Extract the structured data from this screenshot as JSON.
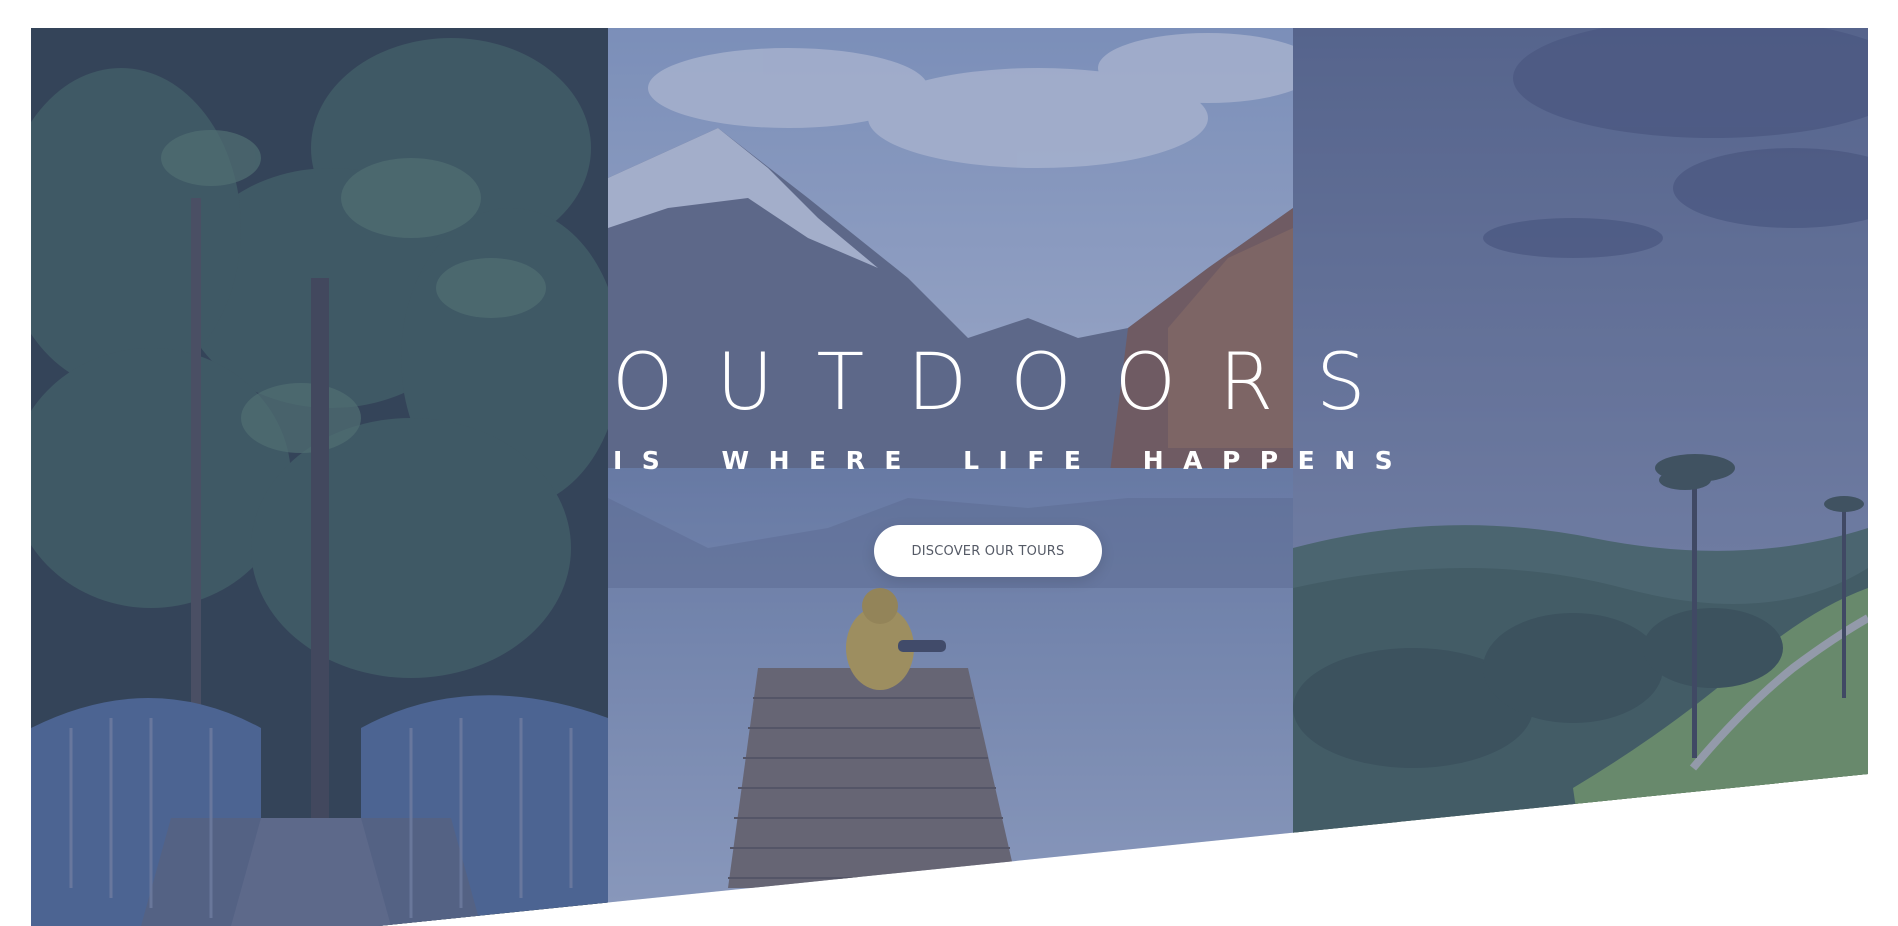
{
  "hero": {
    "headline": "OUTDOORS",
    "subheadline": "IS WHERE LIFE HAPPENS",
    "cta_label": "DISCOVER OUR TOURS"
  },
  "panels": [
    {
      "scene": "forest-bridge"
    },
    {
      "scene": "mountain-lake-pier"
    },
    {
      "scene": "tropical-valley"
    }
  ],
  "colors": {
    "overlay": "#4a5c96",
    "text": "#ffffff",
    "button_bg": "#ffffff",
    "button_text": "#555a66"
  }
}
